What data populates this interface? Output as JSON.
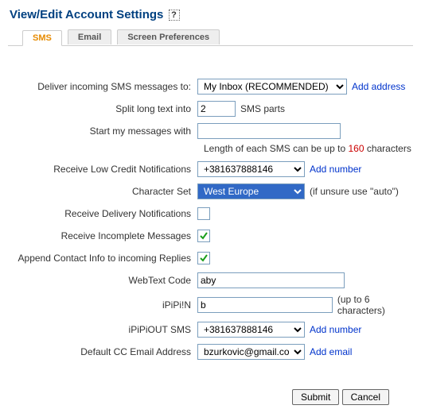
{
  "title": "View/Edit Account Settings",
  "tabs": {
    "sms": "SMS",
    "email": "Email",
    "screen": "Screen Preferences"
  },
  "labels": {
    "deliver": "Deliver incoming SMS messages to:",
    "split": "Split long text into",
    "split_suffix": "SMS parts",
    "start": "Start my messages with",
    "length_a": "Length of each SMS can be up to ",
    "length_n": "160",
    "length_b": " characters",
    "lowcredit": "Receive Low Credit Notifications",
    "charset": "Character Set",
    "charset_hint": "(if unsure use \"auto\")",
    "delivery": "Receive Delivery Notifications",
    "incomplete": "Receive Incomplete Messages",
    "append": "Append Contact Info to incoming Replies",
    "webtext": "WebText Code",
    "ipipin": "iPiPi!N",
    "ipipin_hint": "(up to 6 characters)",
    "ipipiout": "iPiPiOUT SMS",
    "ccemail": "Default CC Email Address"
  },
  "values": {
    "deliver": "My Inbox (RECOMMENDED)",
    "split": "2",
    "start": "",
    "lowcredit_num": "+381637888146",
    "charset": "West Europe",
    "webtext": "aby",
    "ipipin": "b",
    "ipipiout_num": "+381637888146",
    "ccemail": "bzurkovic@gmail.com"
  },
  "checks": {
    "delivery": false,
    "incomplete": true,
    "append": true
  },
  "links": {
    "add_address": "Add address",
    "add_number": "Add number",
    "add_email": "Add email"
  },
  "buttons": {
    "submit": "Submit",
    "cancel": "Cancel"
  }
}
